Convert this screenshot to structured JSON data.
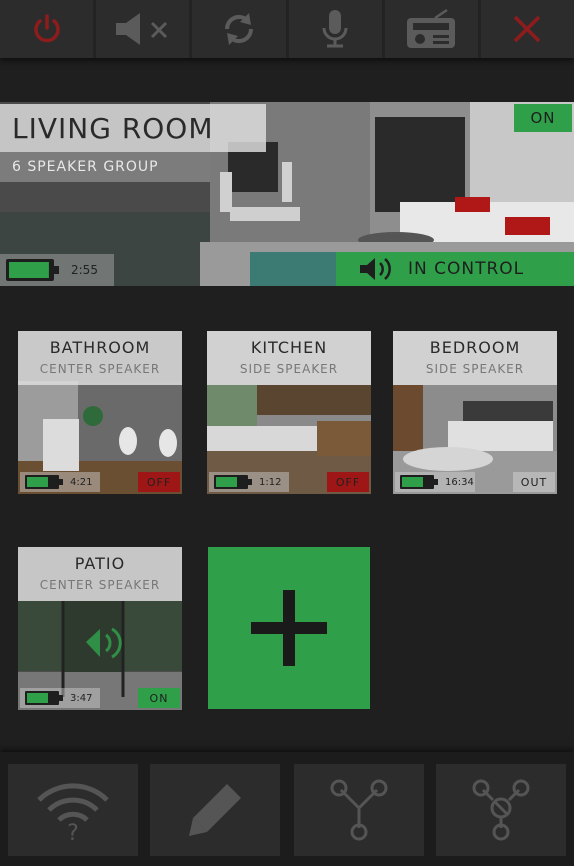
{
  "toolbar": {
    "buttons": [
      {
        "name": "power",
        "icon": "power-icon",
        "color": "#8e1c1c"
      },
      {
        "name": "mute",
        "icon": "speaker-mute-icon",
        "color": "#5b5b5b"
      },
      {
        "name": "refresh",
        "icon": "refresh-icon",
        "color": "#5b5b5b"
      },
      {
        "name": "microphone",
        "icon": "microphone-icon",
        "color": "#5b5b5b"
      },
      {
        "name": "radio",
        "icon": "radio-icon",
        "color": "#5b5b5b"
      },
      {
        "name": "close",
        "icon": "close-icon",
        "color": "#8e1c1c"
      }
    ]
  },
  "main_room": {
    "title": "LIVING ROOM",
    "subtitle": "6 SPEAKER GROUP",
    "status": "ON",
    "battery_time": "2:55",
    "battery_level": 0.95,
    "control_label": "IN CONTROL"
  },
  "rooms": [
    {
      "name": "BATHROOM",
      "type": "CENTER SPEAKER",
      "battery_time": "4:21",
      "battery_level": 0.7,
      "status": "OFF"
    },
    {
      "name": "KITCHEN",
      "type": "SIDE SPEAKER",
      "battery_time": "1:12",
      "battery_level": 0.7,
      "status": "OFF"
    },
    {
      "name": "BEDROOM",
      "type": "SIDE SPEAKER",
      "battery_time": "16:34",
      "battery_level": 0.7,
      "status": "OUT"
    },
    {
      "name": "PATIO",
      "type": "CENTER SPEAKER",
      "battery_time": "3:47",
      "battery_level": 0.7,
      "status": "ON"
    }
  ],
  "add_button": {
    "icon": "plus-icon"
  },
  "bottom_toolbar": {
    "buttons": [
      {
        "name": "wifi-help",
        "icon": "wifi-question-icon"
      },
      {
        "name": "edit",
        "icon": "pencil-icon"
      },
      {
        "name": "group",
        "icon": "group-network-icon"
      },
      {
        "name": "ungroup",
        "icon": "ungroup-network-icon"
      }
    ]
  },
  "colors": {
    "accent_green": "#2f9f4a",
    "status_red": "#9e1616",
    "background": "#1f1f1f"
  }
}
